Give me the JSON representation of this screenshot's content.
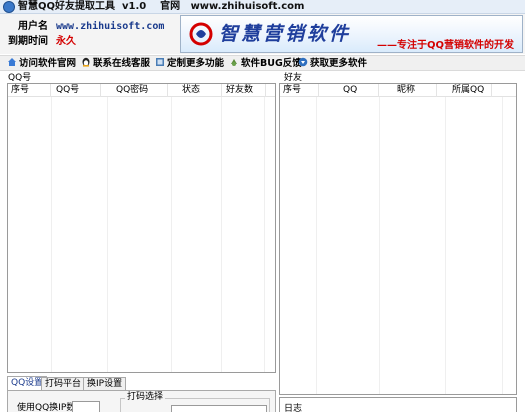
{
  "window": {
    "title": "智慧QQ好友提取工具  v1.0    官网   www.zhihuisoft.com"
  },
  "header": {
    "user_label": "用户名",
    "user_value": "www.zhihuisoft.com",
    "expire_label": "到期时间",
    "expire_value": "永久"
  },
  "banner": {
    "title": "智慧营销软件",
    "slogan": "——专注于QQ营销软件的开发"
  },
  "toolbar": {
    "items": [
      {
        "label": "访问软件官网",
        "icon": "home-icon"
      },
      {
        "label": "联系在线客服",
        "icon": "qq-penguin-icon"
      },
      {
        "label": "定制更多功能",
        "icon": "customize-icon"
      },
      {
        "label": "软件BUG反馈",
        "icon": "bug-icon"
      },
      {
        "label": "获取更多软件",
        "icon": "download-icon"
      }
    ]
  },
  "qq_panel": {
    "label": "QQ号",
    "columns": [
      "序号",
      "QQ号",
      "QQ密码",
      "状态",
      "好友数"
    ]
  },
  "friend_panel": {
    "label": "好友",
    "columns": [
      "序号",
      "QQ",
      "昵称",
      "所属QQ"
    ]
  },
  "tabs": [
    "QQ设置",
    "打码平台",
    "换IP设置"
  ],
  "settings": {
    "ip_switch_label": "使用QQ换IP数",
    "captcha_label": "打码选择"
  },
  "output": {
    "label": "日志"
  },
  "colors": {
    "accent": "#1a3a8c",
    "expire": "#d40000",
    "banner_title": "#1f3e9c"
  }
}
